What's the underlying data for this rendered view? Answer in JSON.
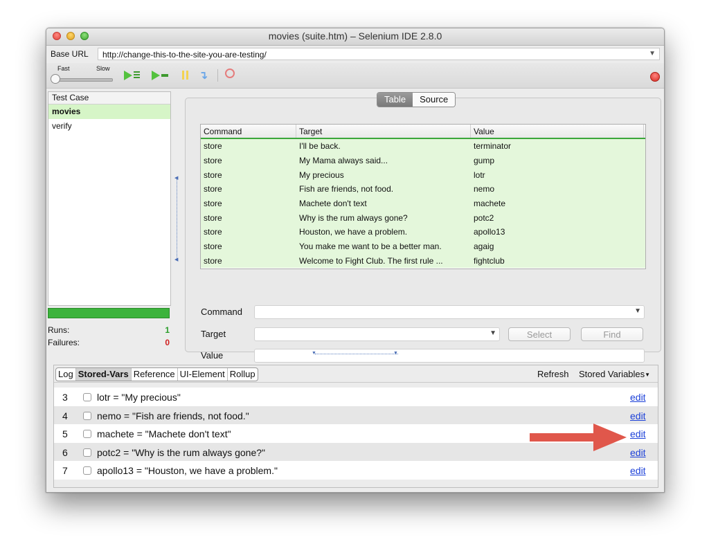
{
  "window": {
    "title": "movies (suite.htm) – Selenium IDE 2.8.0"
  },
  "base_url": {
    "label": "Base URL",
    "value": "http://change-this-to-the-site-you-are-testing/"
  },
  "speed": {
    "fast_label": "Fast",
    "slow_label": "Slow"
  },
  "test_cases": {
    "header": "Test Case",
    "items": [
      {
        "label": "movies"
      },
      {
        "label": "verify"
      }
    ]
  },
  "stats": {
    "runs_label": "Runs:",
    "runs_value": "1",
    "failures_label": "Failures:",
    "failures_value": "0"
  },
  "editor": {
    "tabs": {
      "table": "Table",
      "source": "Source"
    },
    "columns": {
      "command": "Command",
      "target": "Target",
      "value": "Value"
    },
    "rows": [
      {
        "command": "store",
        "target": "I'll be back.",
        "value": "terminator"
      },
      {
        "command": "store",
        "target": "My Mama always said...",
        "value": "gump"
      },
      {
        "command": "store",
        "target": "My precious",
        "value": "lotr"
      },
      {
        "command": "store",
        "target": "Fish are friends, not food.",
        "value": "nemo"
      },
      {
        "command": "store",
        "target": "Machete don't text",
        "value": "machete"
      },
      {
        "command": "store",
        "target": "Why is the rum always gone?",
        "value": "potc2"
      },
      {
        "command": "store",
        "target": "Houston, we have a problem.",
        "value": "apollo13"
      },
      {
        "command": "store",
        "target": "You make me want to be a better man.",
        "value": "agaig"
      },
      {
        "command": "store",
        "target": "Welcome to Fight Club. The first rule ...",
        "value": "fightclub"
      }
    ],
    "fields": {
      "command_label": "Command",
      "target_label": "Target",
      "value_label": "Value"
    },
    "buttons": {
      "select": "Select",
      "find": "Find"
    }
  },
  "bottom_tabs": {
    "log": "Log",
    "stored_vars": "Stored-Vars",
    "reference": "Reference",
    "ui_element": "UI-Element",
    "rollup": "Rollup",
    "refresh": "Refresh",
    "stored_variables": "Stored Variables"
  },
  "stored_vars": [
    {
      "num": "3",
      "text": "lotr = \"My precious\"",
      "edit": "edit"
    },
    {
      "num": "4",
      "text": "nemo = \"Fish are friends, not food.\"",
      "edit": "edit"
    },
    {
      "num": "5",
      "text": "machete = \"Machete don't text\"",
      "edit": "edit"
    },
    {
      "num": "6",
      "text": "potc2 = \"Why is the rum always gone?\"",
      "edit": "edit"
    },
    {
      "num": "7",
      "text": "apollo13 = \"Houston, we have a problem.\"",
      "edit": "edit"
    }
  ],
  "colors": {
    "accent_green": "#3aa73a",
    "row_green": "#e4f7db",
    "annotation_arrow": "#e0574b",
    "link_blue": "#1a3fd8"
  }
}
